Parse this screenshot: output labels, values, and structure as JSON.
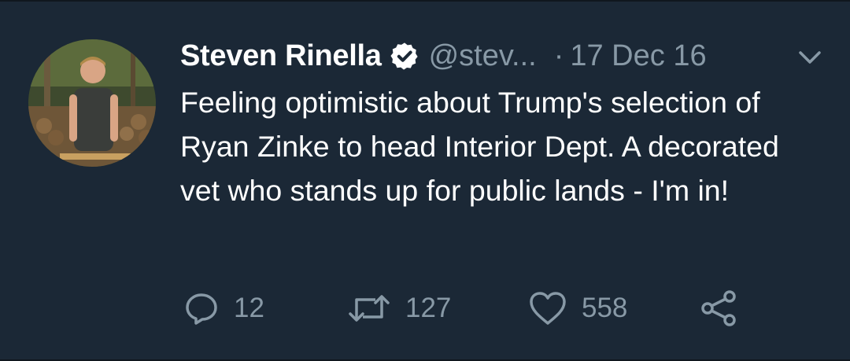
{
  "tweet": {
    "author_name": "Steven Rinella",
    "handle": "@stev...",
    "separator": "·",
    "date": "17 Dec 16",
    "text": "Feeling optimistic about Trump's selection of Ryan Zinke to head Interior Dept. A decorated vet who stands up for public lands - I'm in!",
    "verified": true
  },
  "actions": {
    "reply_count": "12",
    "retweet_count": "127",
    "like_count": "558"
  },
  "icons": {
    "verified": "verified-badge-icon",
    "menu": "chevron-down-icon",
    "reply": "reply-bubble-icon",
    "retweet": "retweet-arrows-icon",
    "like": "heart-icon",
    "share": "share-icon"
  },
  "colors": {
    "background": "#1b2836",
    "text_primary": "#ffffff",
    "text_secondary": "#8899a6"
  }
}
